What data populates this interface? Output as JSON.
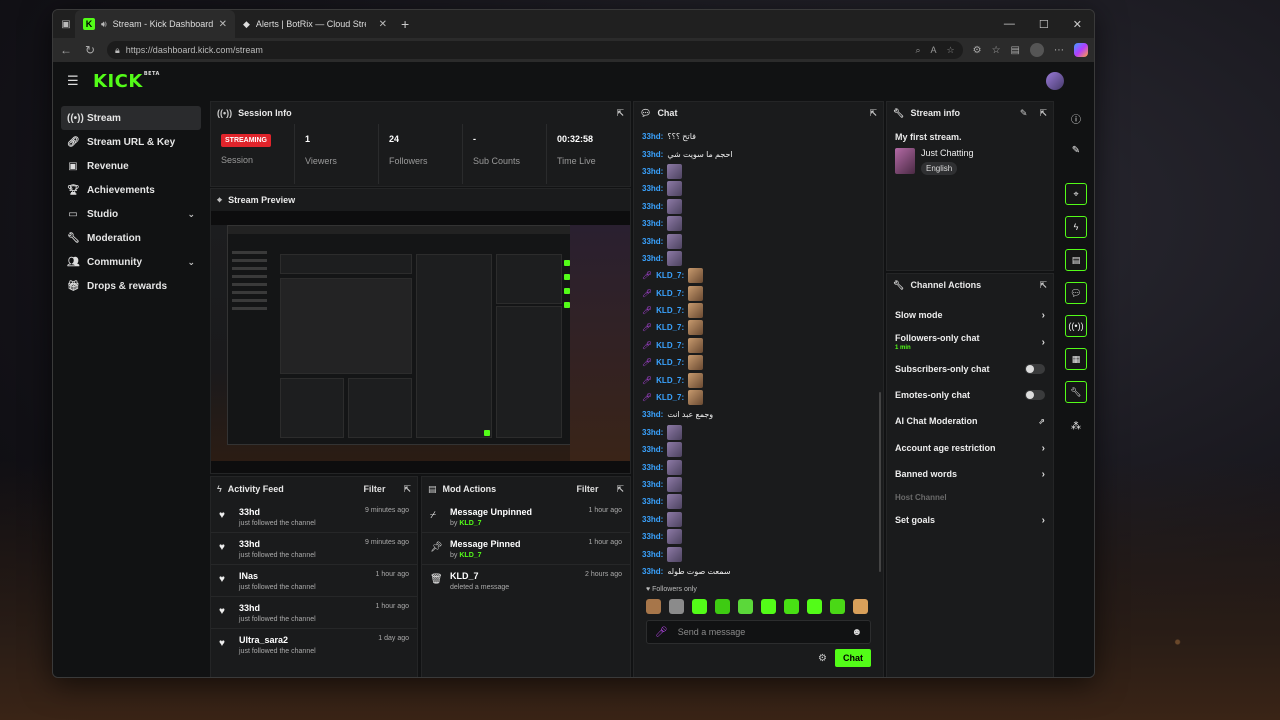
{
  "browser": {
    "tabs": [
      {
        "title": "Stream - Kick Dashboard",
        "active": true
      },
      {
        "title": "Alerts | BotRix — Cloud Streaming",
        "active": false
      }
    ],
    "url": "https://dashboard.kick.com/stream"
  },
  "header": {
    "logo": "KICK",
    "beta": "BETA"
  },
  "sidebar": {
    "items": [
      {
        "label": "Stream",
        "icon": "broadcast-icon"
      },
      {
        "label": "Stream URL & Key",
        "icon": "link-icon"
      },
      {
        "label": "Revenue",
        "icon": "money-icon"
      },
      {
        "label": "Achievements",
        "icon": "trophy-icon"
      },
      {
        "label": "Studio",
        "icon": "studio-icon"
      },
      {
        "label": "Moderation",
        "icon": "wrench-icon"
      },
      {
        "label": "Community",
        "icon": "community-icon"
      },
      {
        "label": "Drops & rewards",
        "icon": "gift-icon"
      }
    ]
  },
  "session": {
    "title": "Session Info",
    "status": "STREAMING",
    "status_label": "Session",
    "viewers": "1",
    "viewers_label": "Viewers",
    "followers": "24",
    "followers_label": "Followers",
    "subs": "-",
    "subs_label": "Sub Counts",
    "time": "00:32:58",
    "time_label": "Time Live"
  },
  "preview": {
    "title": "Stream Preview"
  },
  "activity": {
    "title": "Activity Feed",
    "filter": "Filter",
    "rows": [
      {
        "name": "33hd",
        "desc": "just followed the channel",
        "time": "9 minutes ago"
      },
      {
        "name": "33hd",
        "desc": "just followed the channel",
        "time": "9 minutes ago"
      },
      {
        "name": "INas",
        "desc": "just followed the channel",
        "time": "1 hour ago"
      },
      {
        "name": "33hd",
        "desc": "just followed the channel",
        "time": "1 hour ago"
      },
      {
        "name": "Ultra_sara2",
        "desc": "just followed the channel",
        "time": "1 day ago"
      }
    ]
  },
  "mod": {
    "title": "Mod Actions",
    "filter": "Filter",
    "rows": [
      {
        "action": "Message Unpinned",
        "by": "by",
        "user": "KLD_7",
        "time": "1 hour ago"
      },
      {
        "action": "Message Pinned",
        "by": "by",
        "user": "KLD_7",
        "time": "1 hour ago"
      },
      {
        "action": "KLD_7",
        "desc": "deleted a message",
        "time": "2 hours ago"
      }
    ]
  },
  "chat": {
    "title": "Chat",
    "messages": [
      {
        "user": "33hd:",
        "text": "فاتح ؟؟؟"
      },
      {
        "user": "33hd:",
        "text": "احجم ما سويت شي"
      },
      {
        "user": "33hd:",
        "emote": true
      },
      {
        "user": "33hd:",
        "emote": true
      },
      {
        "user": "33hd:",
        "emote": true
      },
      {
        "user": "33hd:",
        "emote": true
      },
      {
        "user": "33hd:",
        "emote": true
      },
      {
        "user": "33hd:",
        "emote": true
      },
      {
        "user": "KLD_7:",
        "emote": true,
        "mic": true
      },
      {
        "user": "KLD_7:",
        "emote": true,
        "mic": true
      },
      {
        "user": "KLD_7:",
        "emote": true,
        "mic": true
      },
      {
        "user": "KLD_7:",
        "emote": true,
        "mic": true
      },
      {
        "user": "KLD_7:",
        "emote": true,
        "mic": true
      },
      {
        "user": "KLD_7:",
        "emote": true,
        "mic": true
      },
      {
        "user": "KLD_7:",
        "emote": true,
        "mic": true
      },
      {
        "user": "KLD_7:",
        "emote": true,
        "mic": true
      },
      {
        "user": "33hd:",
        "text": "وجمع عبد انت"
      },
      {
        "user": "33hd:",
        "emote": true
      },
      {
        "user": "33hd:",
        "emote": true
      },
      {
        "user": "33hd:",
        "emote": true
      },
      {
        "user": "33hd:",
        "emote": true
      },
      {
        "user": "33hd:",
        "emote": true
      },
      {
        "user": "33hd:",
        "emote": true
      },
      {
        "user": "33hd:",
        "emote": true
      },
      {
        "user": "33hd:",
        "emote": true
      },
      {
        "user": "33hd:",
        "text": "سمعت صوت طوله"
      },
      {
        "user": "33hd:",
        "emote": true
      }
    ],
    "followers_only": "Followers only",
    "placeholder": "Send a message",
    "send": "Chat"
  },
  "stream_info": {
    "title": "Stream info",
    "stream_title": "My first stream.",
    "category": "Just Chatting",
    "language": "English"
  },
  "channel_actions": {
    "title": "Channel Actions",
    "items": [
      {
        "label": "Slow mode"
      },
      {
        "label": "Followers-only chat",
        "sub": "1 min"
      },
      {
        "label": "Subscribers-only chat"
      },
      {
        "label": "Emotes-only chat"
      },
      {
        "label": "AI Chat Moderation"
      },
      {
        "label": "Account age restriction"
      },
      {
        "label": "Banned words"
      },
      {
        "label": "Host Channel"
      },
      {
        "label": "Set goals"
      }
    ]
  },
  "colors": {
    "accent": "#53fc18",
    "live": "#e0242b",
    "username": "#3aa3ff"
  }
}
